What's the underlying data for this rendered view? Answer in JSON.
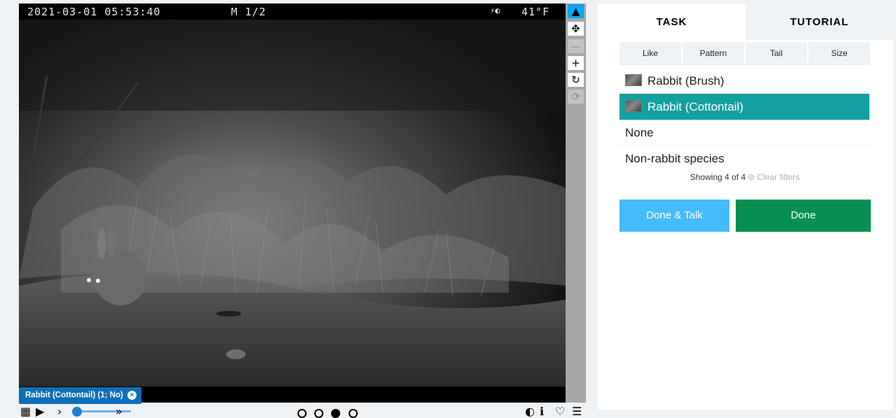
{
  "camera": {
    "datetime": "2021-03-01  05:53:40",
    "mode": "M 1/2",
    "moon": "⚡◐",
    "temperature": "41°F"
  },
  "toolbar": {
    "tools": [
      {
        "name": "pointer-tool-button",
        "icon": "▲"
      },
      {
        "name": "move-tool-button",
        "icon": "✥"
      },
      {
        "name": "zoom-out-button",
        "icon": "—"
      },
      {
        "name": "zoom-in-button",
        "icon": "+"
      },
      {
        "name": "rotate-button",
        "icon": "↻"
      },
      {
        "name": "reset-button",
        "icon": "⟳"
      }
    ]
  },
  "mark_label": {
    "text": "Rabbit (Cottontail) (1; No)",
    "close": "×"
  },
  "controls": {
    "grid_icon": "▦",
    "play_icon": "▶",
    "next_icon": "›",
    "fast_icon": "»",
    "frame_dots": [
      "empty",
      "empty",
      "filled",
      "empty"
    ],
    "frame_position": 0.25,
    "contrast_icon": "◐",
    "info_icon": "ℹ",
    "favorite_icon": "♡",
    "collection_icon": "☰"
  },
  "panel": {
    "tabs": [
      "TASK",
      "TUTORIAL"
    ],
    "filters": [
      "Like",
      "Pattern",
      "Tail",
      "Size"
    ],
    "choices": [
      {
        "label": "Rabbit (Brush)",
        "thumb": true,
        "selected": false
      },
      {
        "label": "Rabbit (Cottontail)",
        "thumb": true,
        "selected": true
      },
      {
        "label": "None",
        "thumb": false,
        "selected": false
      },
      {
        "label": "Non-rabbit species",
        "thumb": false,
        "selected": false
      }
    ],
    "showing_text": "Showing 4 of 4",
    "clear_filters": "⊘ Clear filters",
    "done_talk_label": "Done & Talk",
    "done_label": "Done"
  },
  "colors": {
    "accent_tool": "#00a7ff",
    "selected_choice": "#12a0a0",
    "done_talk": "#43bbfd",
    "done": "#078f52",
    "mark_label": "#0e6eb8"
  }
}
